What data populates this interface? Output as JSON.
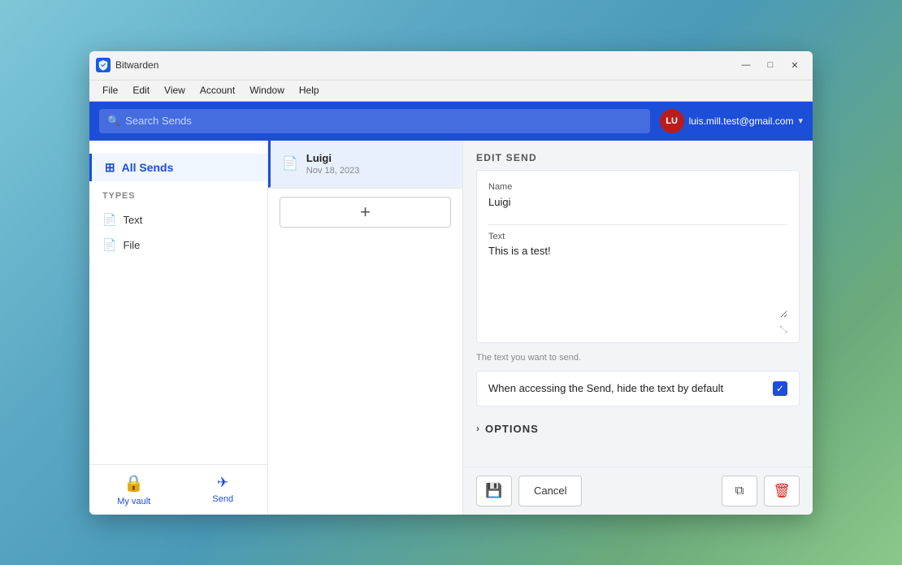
{
  "window": {
    "title": "Bitwarden",
    "controls": {
      "minimize": "—",
      "maximize": "□",
      "close": "✕"
    }
  },
  "menubar": {
    "items": [
      "File",
      "Edit",
      "View",
      "Account",
      "Window",
      "Help"
    ]
  },
  "header": {
    "search_placeholder": "Search Sends",
    "user": {
      "initials": "LU",
      "email": "luis.mill.test@gmail.com"
    }
  },
  "sidebar": {
    "all_sends_label": "All Sends",
    "types_label": "TYPES",
    "types": [
      {
        "label": "Text"
      },
      {
        "label": "File"
      }
    ],
    "footer": [
      {
        "label": "My vault",
        "icon": "🔒"
      },
      {
        "label": "Send",
        "icon": "✉"
      }
    ]
  },
  "send_list": {
    "items": [
      {
        "name": "Luigi",
        "date": "Nov 18, 2023"
      }
    ],
    "add_label": "+"
  },
  "edit_send": {
    "header": "EDIT SEND",
    "fields": {
      "name_label": "Name",
      "name_value": "Luigi",
      "text_label": "Text",
      "text_value": "This is a test!",
      "helper_text": "The text you want to send.",
      "hide_checkbox_label": "When accessing the Send, hide the text by default",
      "hide_checked": true,
      "options_label": "OPTIONS"
    },
    "footer_buttons": {
      "save_icon": "💾",
      "cancel_label": "Cancel",
      "copy_icon": "⧉",
      "delete_icon": "🗑"
    }
  }
}
